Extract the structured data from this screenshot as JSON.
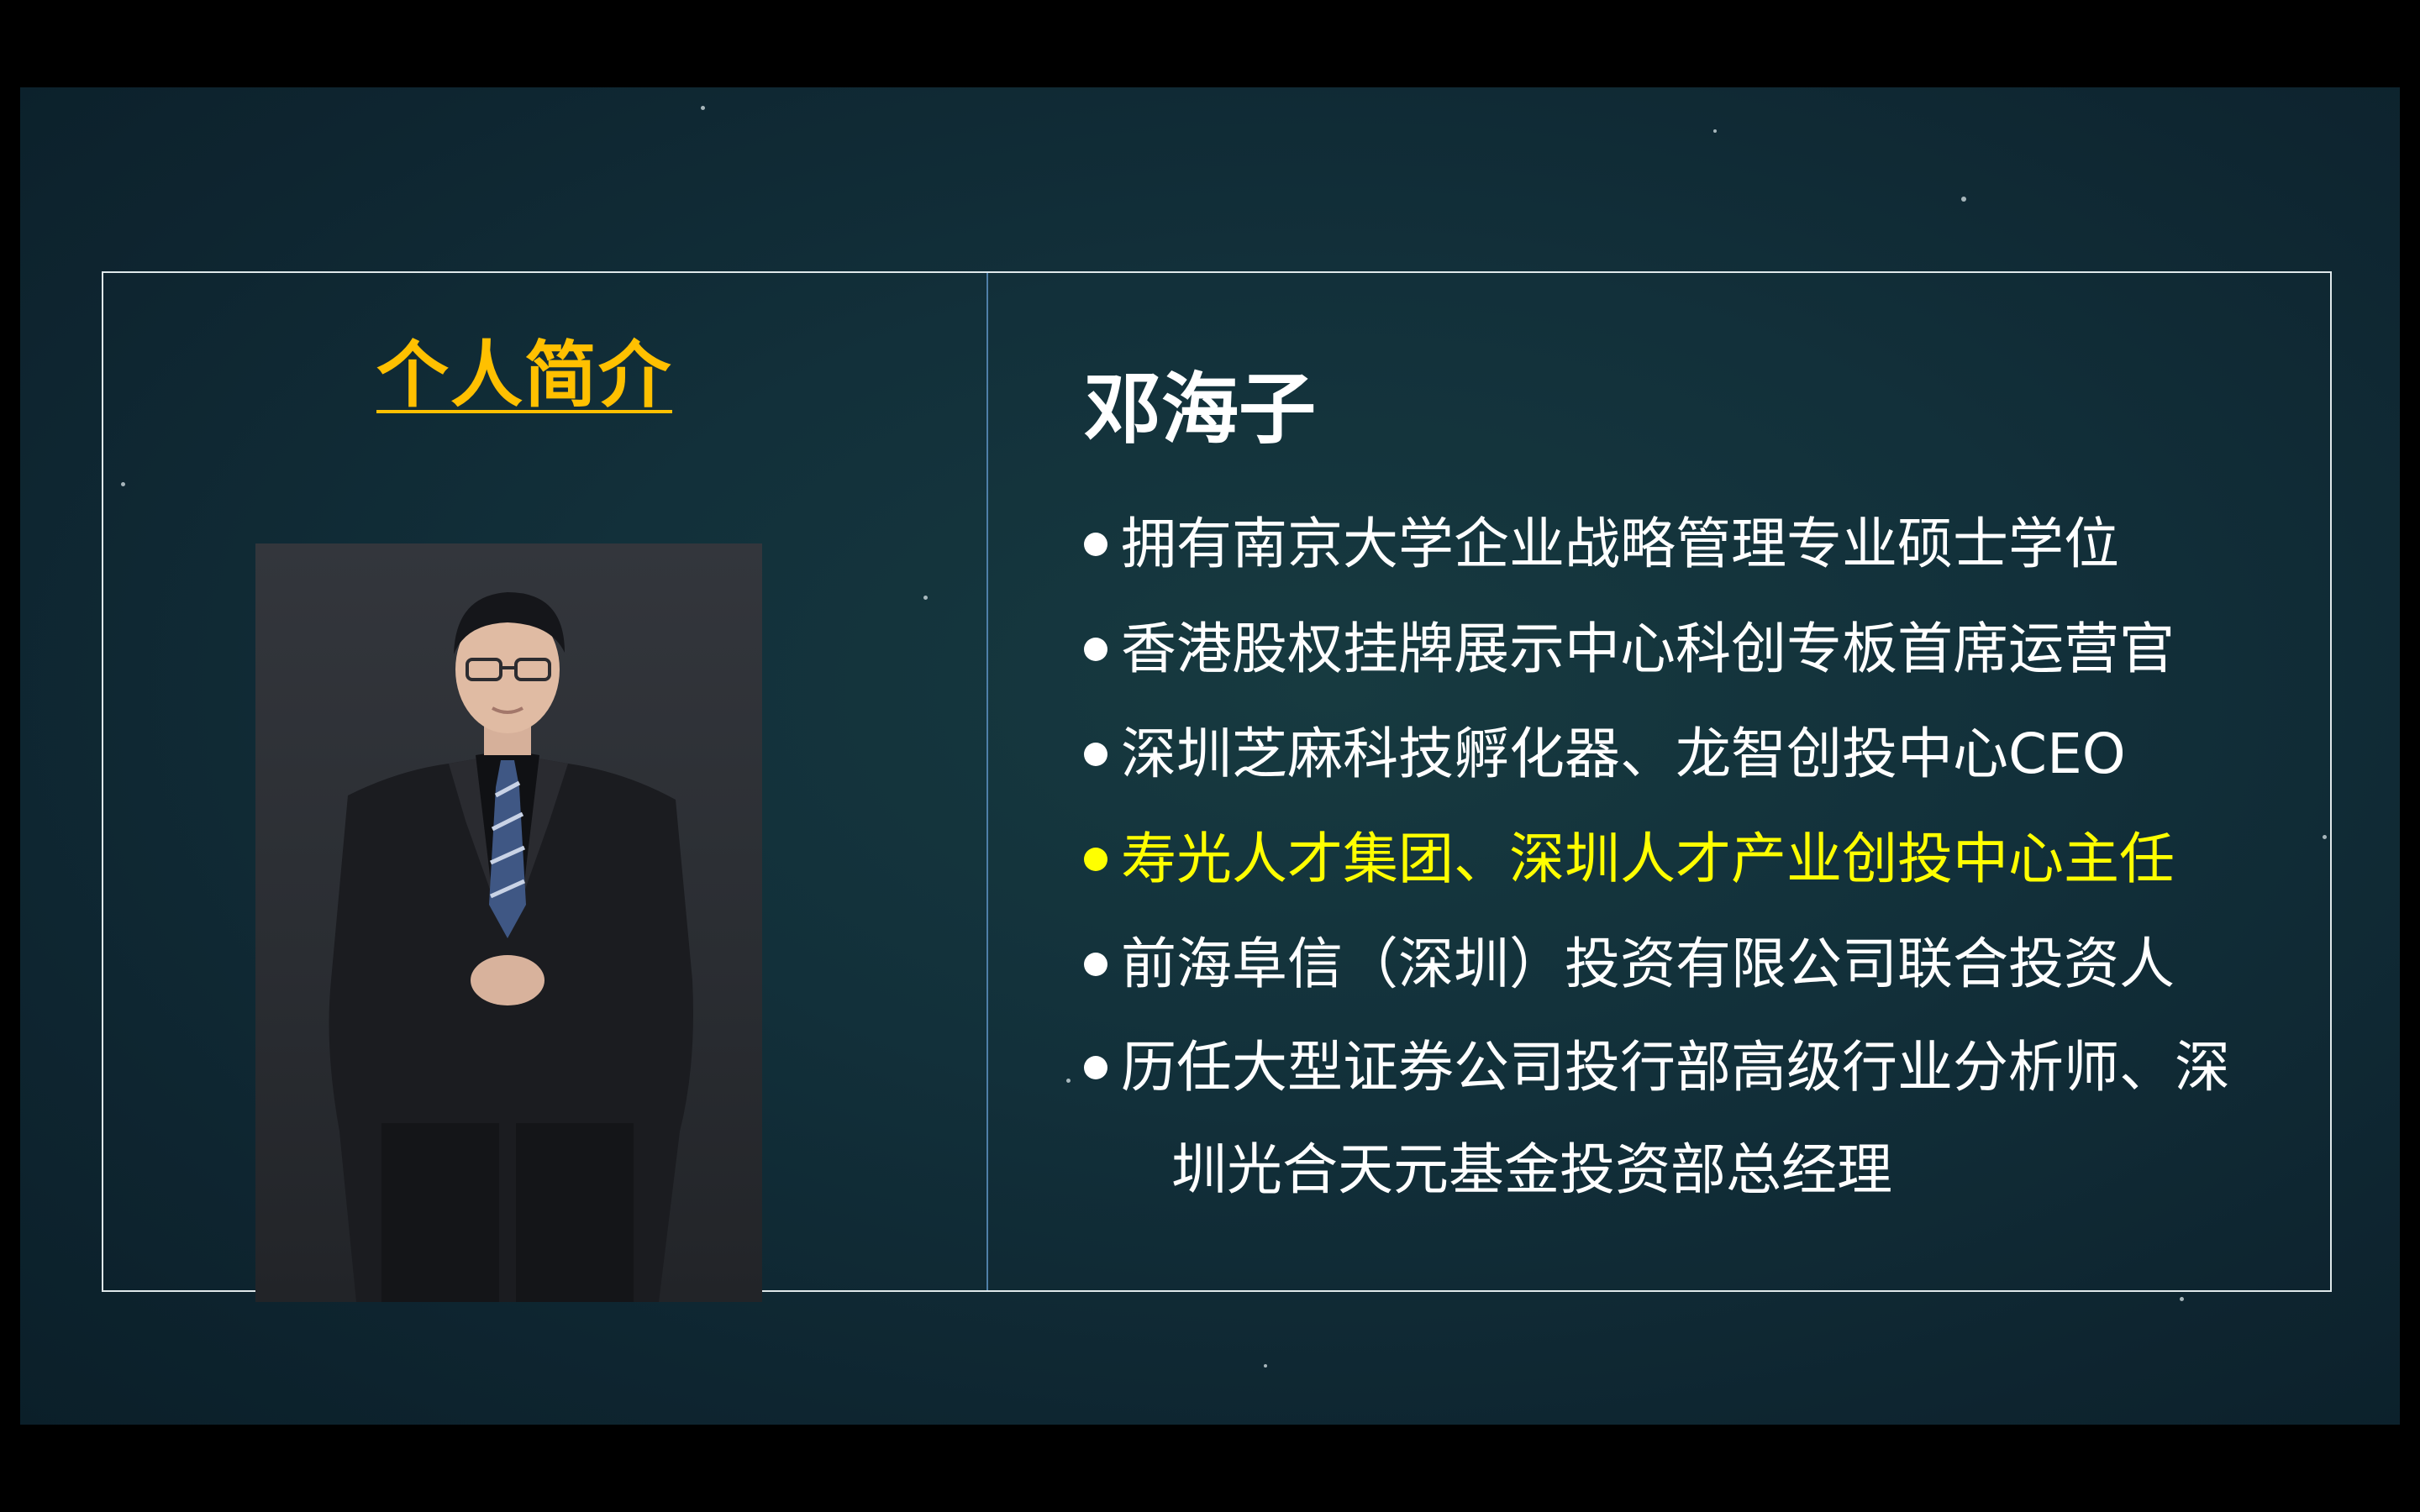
{
  "section_title": "个人简介",
  "profile": {
    "name": "邓海子",
    "photo_alt": "portrait"
  },
  "bullets": [
    {
      "text": "拥有南京大学企业战略管理专业硕士学位",
      "highlight": false
    },
    {
      "text": "香港股权挂牌展示中心科创专板首席运营官",
      "highlight": false
    },
    {
      "text": "深圳芝麻科技孵化器、龙智创投中心CEO",
      "highlight": false
    },
    {
      "text": "寿光人才集团、深圳人才产业创投中心主任",
      "highlight": true
    },
    {
      "text": "前海阜信（深圳）投资有限公司联合投资人",
      "highlight": false
    },
    {
      "text_line1": "历任大型证券公司投行部高级行业分析师、深",
      "text_line2": "圳光合天元基金投资部总经理",
      "highlight": false
    }
  ],
  "colors": {
    "title": "#ffc000",
    "highlight": "#ffff00",
    "text": "#ffffff",
    "frame": "#dfe8ea",
    "divider": "#4f7fa8"
  }
}
